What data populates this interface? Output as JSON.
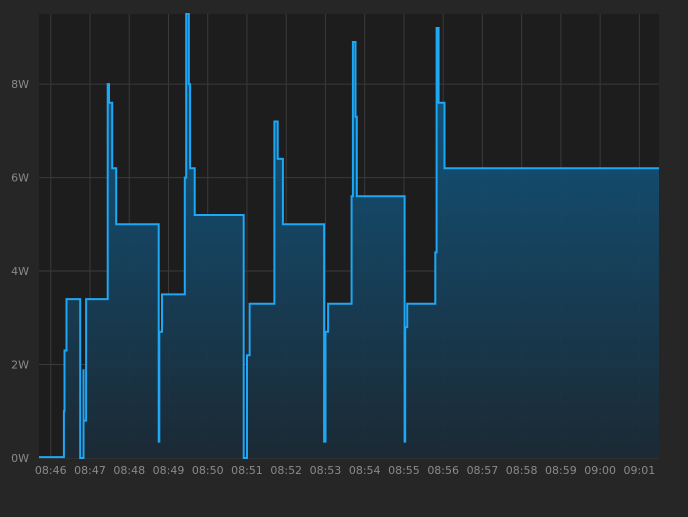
{
  "chart_data": {
    "type": "area",
    "title": "",
    "xlabel": "",
    "ylabel": "",
    "y_unit": "W",
    "ylim": [
      0,
      9.5
    ],
    "xlim": [
      "08:45:42",
      "09:01:30"
    ],
    "y_ticks": [
      0,
      2,
      4,
      6,
      8
    ],
    "y_tick_labels": [
      "0W",
      "2W",
      "4W",
      "6W",
      "8W"
    ],
    "x_ticks": [
      "08:46",
      "08:47",
      "08:48",
      "08:49",
      "08:50",
      "08:51",
      "08:52",
      "08:53",
      "08:54",
      "08:55",
      "08:56",
      "08:57",
      "08:58",
      "08:59",
      "09:00",
      "09:01"
    ],
    "grid": true,
    "step": true,
    "colors": {
      "line": "#1ea7f5",
      "fill_top": "#0f5f8f",
      "fill_bottom": "#1b2a35",
      "grid": "#3a3a3a",
      "plot_bg": "#1d1d1d",
      "page_bg": "#262626",
      "tick_label": "#8a8a8a"
    },
    "series": [
      {
        "x": [
          "08:45:42",
          "08:46:18",
          "08:46:20",
          "08:46:21",
          "08:46:24",
          "08:46:45",
          "08:46:45",
          "08:46:50",
          "08:46:50",
          "08:46:54",
          "08:47:26",
          "08:47:27",
          "08:47:29",
          "08:47:34",
          "08:47:38",
          "08:47:40",
          "08:48:44",
          "08:48:45",
          "08:48:46",
          "08:48:50",
          "08:49:24",
          "08:49:25",
          "08:49:27",
          "08:49:31",
          "08:49:33",
          "08:49:38",
          "08:49:40",
          "08:50:09",
          "08:50:55",
          "08:50:55",
          "08:51:00",
          "08:51:04",
          "08:51:37",
          "08:51:42",
          "08:51:47",
          "08:51:50",
          "08:51:55",
          "08:52:36",
          "08:52:58",
          "08:52:58",
          "08:53:00",
          "08:53:04",
          "08:53:38",
          "08:53:40",
          "08:53:42",
          "08:53:46",
          "08:53:48",
          "08:53:55",
          "08:54:58",
          "08:55:01",
          "08:55:02",
          "08:55:05",
          "08:55:46",
          "08:55:48",
          "08:55:50",
          "08:55:53",
          "08:55:57",
          "08:56:02",
          "08:56:06",
          "09:01:30"
        ],
        "y": [
          0.02,
          0.02,
          1.0,
          2.3,
          3.4,
          3.4,
          0.0,
          1.9,
          0.8,
          3.4,
          3.4,
          8.0,
          7.6,
          6.2,
          6.2,
          5.0,
          5.0,
          0.35,
          2.7,
          3.5,
          3.5,
          6.0,
          9.5,
          8.0,
          6.2,
          6.2,
          5.2,
          5.2,
          5.2,
          0.0,
          2.2,
          3.3,
          3.3,
          7.2,
          6.4,
          6.4,
          5.0,
          5.0,
          5.0,
          0.35,
          2.7,
          3.3,
          3.3,
          5.6,
          8.9,
          7.3,
          5.6,
          5.6,
          5.6,
          0.35,
          2.8,
          3.3,
          3.3,
          4.4,
          9.2,
          7.6,
          7.6,
          6.2,
          6.2,
          6.2
        ]
      }
    ]
  }
}
